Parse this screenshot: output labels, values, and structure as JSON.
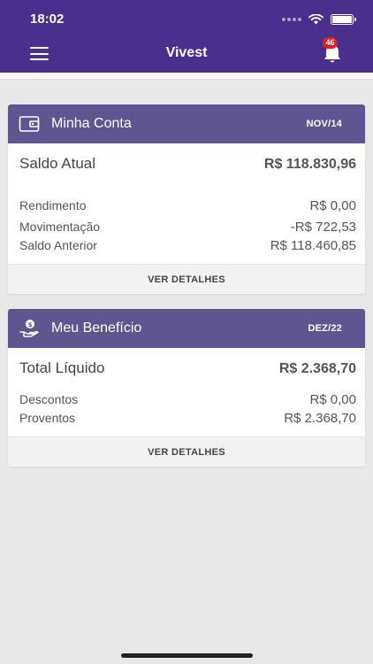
{
  "status_bar": {
    "time": "18:02"
  },
  "header": {
    "title": "Vivest",
    "notification_count": "46"
  },
  "account_card": {
    "title": "Minha Conta",
    "period": "NOV/14",
    "main": {
      "label": "Saldo Atual",
      "value": "R$ 118.830,96"
    },
    "rows": [
      {
        "label": "Rendimento",
        "value": "R$ 0,00"
      },
      {
        "label": "Movimentação",
        "value": "-R$ 722,53"
      },
      {
        "label": "Saldo Anterior",
        "value": "R$ 118.460,85"
      }
    ],
    "details_label": "VER DETALHES"
  },
  "benefit_card": {
    "title": "Meu Benefício",
    "period": "DEZ/22",
    "main": {
      "label": "Total Líquido",
      "value": "R$ 2.368,70"
    },
    "rows": [
      {
        "label": "Descontos",
        "value": "R$ 0,00"
      },
      {
        "label": "Proventos",
        "value": "R$ 2.368,70"
      }
    ],
    "details_label": "VER DETALHES"
  },
  "colors": {
    "header_bg": "#4a2f8c",
    "card_header_bg": "#5f5590",
    "badge": "#e02020",
    "page_bg": "#e8e8e8"
  },
  "icons": {
    "menu": "hamburger-menu-icon",
    "notifications": "bell-icon",
    "account": "wallet-icon",
    "benefit": "hand-money-icon"
  }
}
